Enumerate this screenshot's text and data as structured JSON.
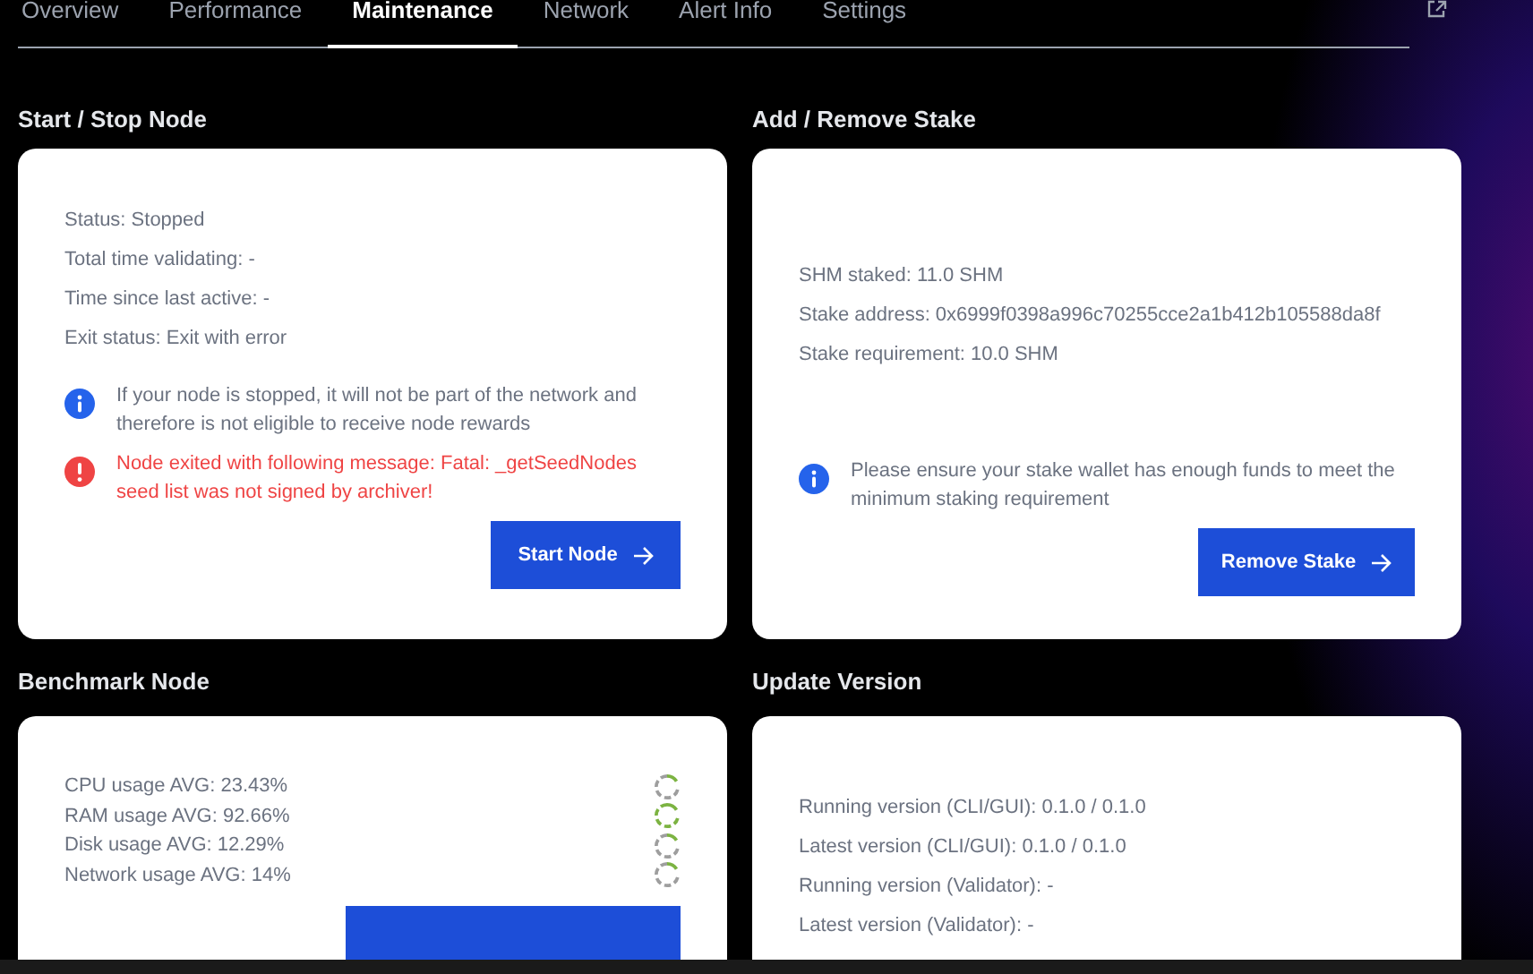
{
  "tabs": [
    {
      "label": "Overview",
      "selected": false
    },
    {
      "label": "Performance",
      "selected": false
    },
    {
      "label": "Maintenance",
      "selected": true
    },
    {
      "label": "Network",
      "selected": false
    },
    {
      "label": "Alert Info",
      "selected": false
    },
    {
      "label": "Settings",
      "selected": false
    }
  ],
  "start_stop": {
    "title": "Start / Stop Node",
    "lines": [
      "Status: Stopped",
      "Total time validating: -",
      "Time since last active: -",
      "Exit status: Exit with error"
    ],
    "notices": [
      {
        "kind": "info",
        "text": "If your node is stopped, it will not be part of the network and therefore is not eligible to receive node rewards"
      },
      {
        "kind": "error",
        "text": "Node exited with following message: Fatal: _getSeedNodes seed list was not signed by archiver!"
      }
    ],
    "button": "Start Node"
  },
  "stake": {
    "title": "Add / Remove Stake",
    "lines": [
      "SHM staked: 11.0 SHM",
      "Stake address: 0x6999f0398a996c70255cce2a1b412b105588da8f",
      "Stake requirement: 10.0 SHM"
    ],
    "notices": [
      {
        "kind": "info",
        "text": "Please ensure your stake wallet has enough funds to meet the minimum staking requirement"
      }
    ],
    "button": "Remove Stake"
  },
  "benchmark": {
    "title": "Benchmark Node",
    "metrics": [
      {
        "label": "CPU usage AVG: 23.43%",
        "color": "#9e9e9e"
      },
      {
        "label": "RAM usage AVG: 92.66%",
        "color": "#7cb342"
      },
      {
        "label": "Disk usage AVG: 12.29%",
        "color": "#9e9e9e"
      },
      {
        "label": "Network usage AVG: 14%",
        "color": "#9e9e9e"
      }
    ]
  },
  "update": {
    "title": "Update Version",
    "lines": [
      "Running version (CLI/GUI): 0.1.0 / 0.1.0",
      "Latest version (CLI/GUI): 0.1.0 / 0.1.0",
      "Running version (Validator): -",
      "Latest version (Validator): -"
    ]
  }
}
